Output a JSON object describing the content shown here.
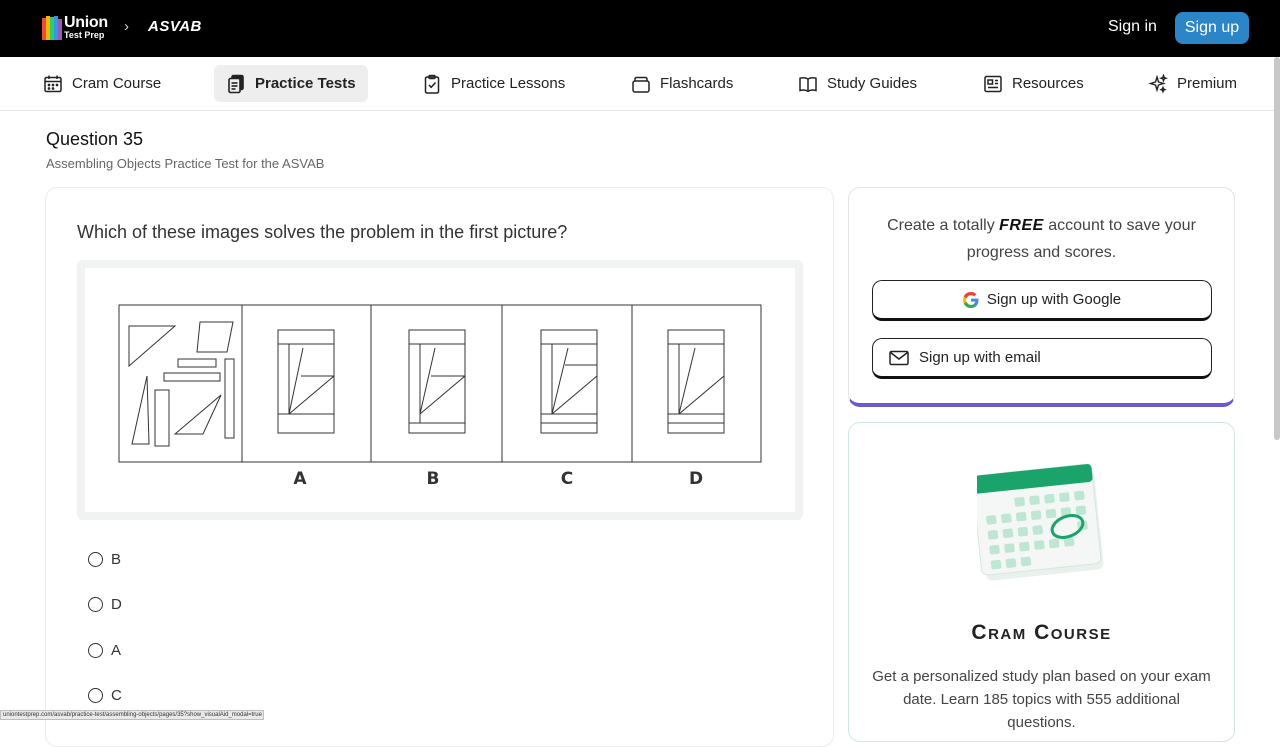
{
  "header": {
    "logo_line1": "Union",
    "logo_line2": "Test Prep",
    "breadcrumb_chevron": "›",
    "breadcrumb_section": "ASVAB",
    "signin_label": "Sign in",
    "signup_label": "Sign up"
  },
  "nav": {
    "items": [
      {
        "label": "Cram Course",
        "icon": "calendar-icon"
      },
      {
        "label": "Practice Tests",
        "icon": "test-copy-icon"
      },
      {
        "label": "Practice Lessons",
        "icon": "clipboard-check-icon"
      },
      {
        "label": "Flashcards",
        "icon": "cards-stack-icon"
      },
      {
        "label": "Study Guides",
        "icon": "open-book-icon"
      },
      {
        "label": "Resources",
        "icon": "newspaper-icon"
      },
      {
        "label": "Premium",
        "icon": "sparkles-icon"
      }
    ],
    "active_index": 1
  },
  "question": {
    "title": "Question 35",
    "subtitle": "Assembling Objects Practice Test for the ASVAB",
    "prompt": "Which of these images solves the problem in the first picture?",
    "figure_labels": [
      "A",
      "B",
      "C",
      "D"
    ],
    "options": [
      "B",
      "D",
      "A",
      "C"
    ]
  },
  "signup_card": {
    "text_before": "Create a totally ",
    "text_free": "FREE",
    "text_after": " account to save your progress and scores.",
    "google_label": "Sign up with Google",
    "email_label": "Sign up with email"
  },
  "cram_card": {
    "title": "Cram Course",
    "description": "Get a personalized study plan based on your exam date. Learn 185 topics with 555 additional questions."
  },
  "status_bar": "uniontestprep.com/asvab/practice-test/assembling-objects/pages/35?show_visualAid_modal=true",
  "colors": {
    "accent_blue": "#2c85c6",
    "signup_border": "#6a5acd",
    "cram_green": "#1aa36b"
  }
}
